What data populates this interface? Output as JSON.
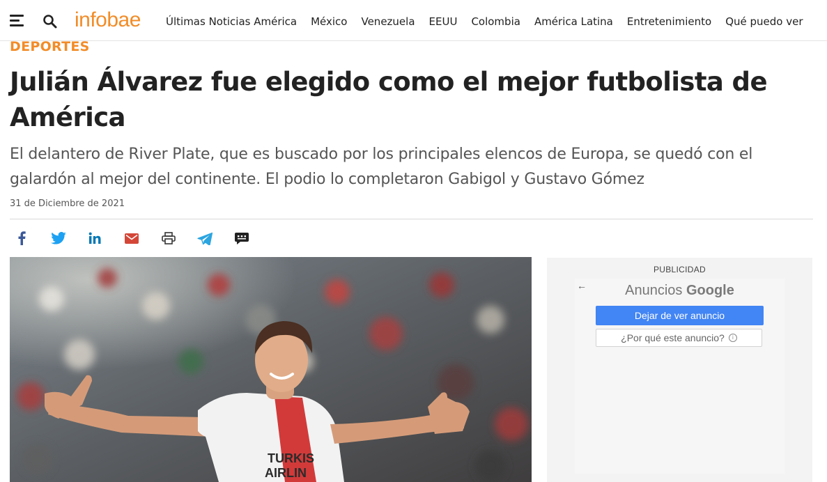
{
  "header": {
    "logo": "infobae",
    "nav": [
      "Últimas Noticias América",
      "México",
      "Venezuela",
      "EEUU",
      "Colombia",
      "América Latina",
      "Entretenimiento",
      "Qué puedo ver"
    ]
  },
  "article": {
    "section": "DEPORTES",
    "title": "Julián Álvarez fue elegido como el mejor futbolista de América",
    "subtitle": "El delantero de River Plate, que es buscado por los principales elencos de Europa, se quedó con el galardón al mejor del continente. El podio lo completaron Gabigol y Gustavo Gómez",
    "date": "31 de Diciembre de 2021"
  },
  "share": {
    "icons": [
      "facebook-icon",
      "twitter-icon",
      "linkedin-icon",
      "email-icon",
      "print-icon",
      "telegram-icon",
      "comments-icon"
    ]
  },
  "ad": {
    "label": "PUBLICIDAD",
    "brand_prefix": "Anuncios ",
    "brand_name": "Google",
    "stop_label": "Dejar de ver anuncio",
    "why_label": "¿Por qué este anuncio?"
  },
  "colors": {
    "accent": "#f28c28",
    "ad_button": "#4285f4",
    "facebook": "#3b5998",
    "twitter": "#1da1f2",
    "linkedin": "#0077b5",
    "email": "#d44638",
    "telegram": "#2ca5e0"
  }
}
